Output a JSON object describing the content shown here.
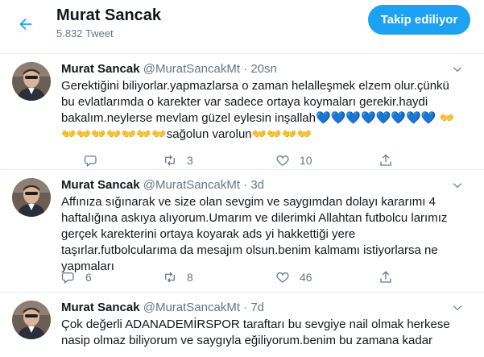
{
  "header": {
    "name": "Murat Sancak",
    "tweet_count": "5.832 Tweet",
    "follow_button": "Takip ediliyor"
  },
  "colors": {
    "accent": "#1da1f2",
    "border": "#e6ecf0",
    "secondary_text": "#657786"
  },
  "tweets": [
    {
      "author": "Murat Sancak",
      "handle": "@MuratSancakMt",
      "dot": "·",
      "time": "20sn",
      "text": "Gerektiğini biliyorlar.yapmazlarsa o zaman helalleşmek elzem olur.çünkü bu evlatlarımda o karekter var sadece ortaya koymaları gerekir.haydi bakalım.neylerse mevlam güzel eylesin inşallah💙💙💙💙💙💙💙💙 👐👐👐👐👐👐👐👐sağolun varolun👐👐👐👐",
      "replies": "",
      "retweets": "3",
      "likes": "10"
    },
    {
      "author": "Murat Sancak",
      "handle": "@MuratSancakMt",
      "dot": "·",
      "time": "3d",
      "text": "Affınıza sığınarak ve size olan sevgim ve saygımdan dolayı kararımı 4 haftalığına askıya alıyorum.Umarım ve dilerimki Allahtan futbolcu larımız gerçek karekterini ortaya koyarak ads yi hakkettiği yere taşırlar.futbolcularıma da mesajım olsun.benim kalmamı istiyorlarsa ne yapmaları",
      "replies": "6",
      "retweets": "8",
      "likes": "46"
    },
    {
      "author": "Murat Sancak",
      "handle": "@MuratSancakMt",
      "dot": "·",
      "time": "7d",
      "text": "Çok değerli ADANADEMİRSPOR taraftarı bu sevgiye nail olmak herkese nasip olmaz biliyorum ve saygıyla eğiliyorum.benim bu zamana kadar",
      "replies": "",
      "retweets": "",
      "likes": ""
    }
  ]
}
